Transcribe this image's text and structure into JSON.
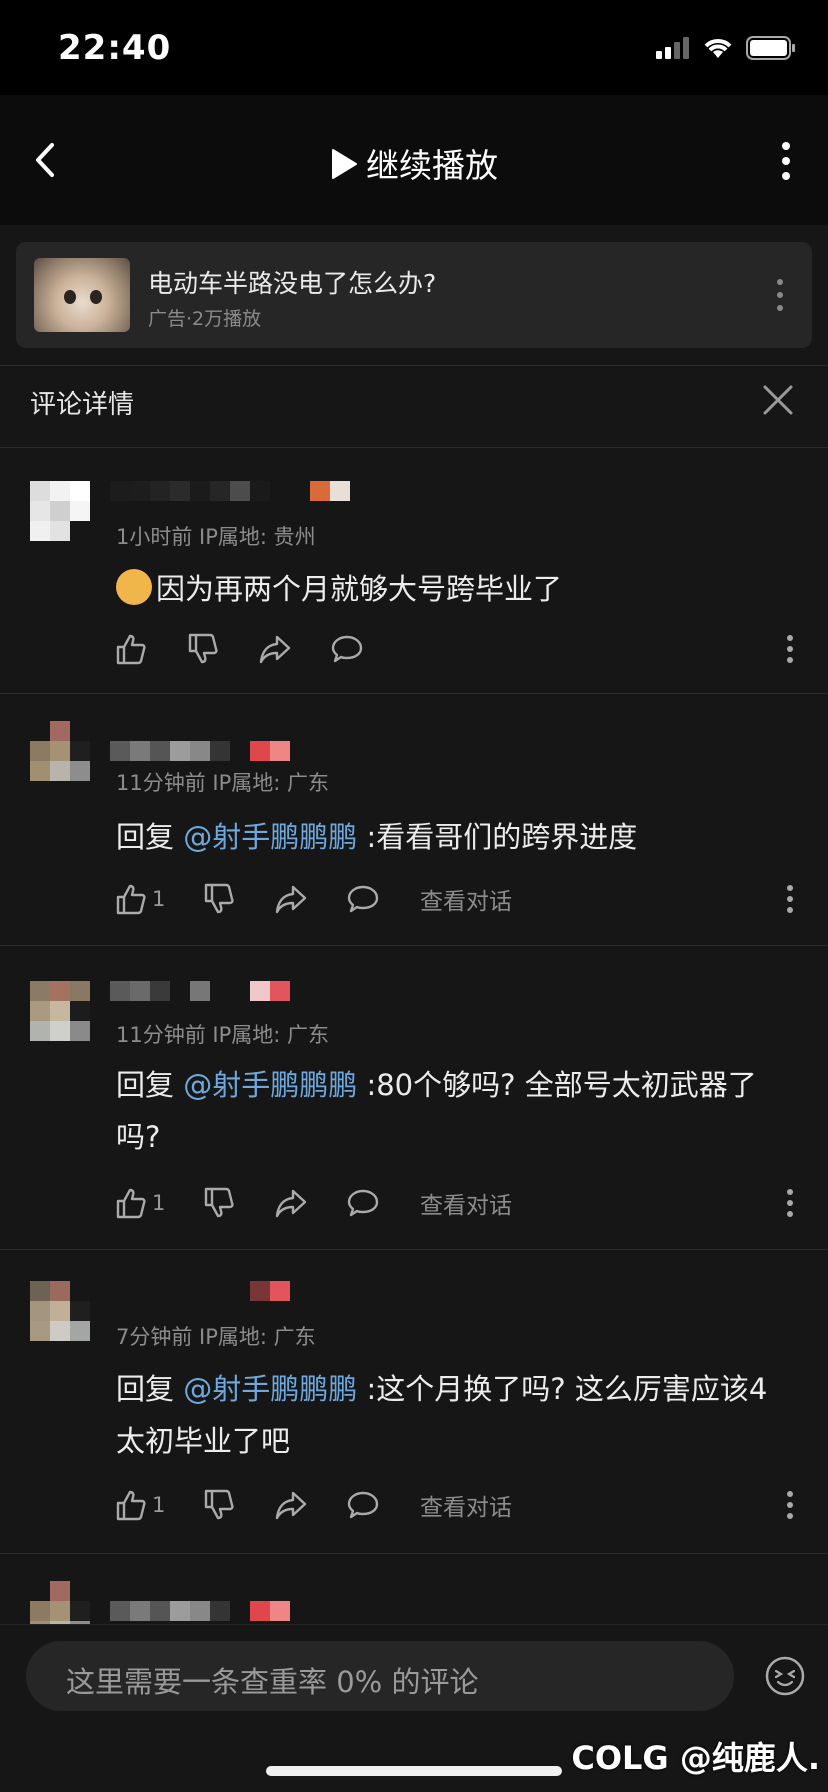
{
  "status": {
    "time": "22:40"
  },
  "nav": {
    "title": "继续播放"
  },
  "ad": {
    "title": "电动车半路没电了怎么办?",
    "subtitle": "广告·2万播放"
  },
  "comments_header": {
    "title": "评论详情"
  },
  "comments": [
    {
      "meta": "1小时前 IP属地: 贵州",
      "text": "因为再两个月就够大号跨毕业了",
      "like_count": ""
    },
    {
      "meta": "11分钟前 IP属地: 广东",
      "reply_prefix": "回复 ",
      "mention": "@射手鹏鹏鹏",
      "text": " :看看哥们的跨界进度",
      "like_count": "1",
      "view_conversation": "查看对话"
    },
    {
      "meta": "11分钟前 IP属地: 广东",
      "reply_prefix": "回复 ",
      "mention": "@射手鹏鹏鹏",
      "text": " :80个够吗? 全部号太初武器了吗?",
      "like_count": "1",
      "view_conversation": "查看对话"
    },
    {
      "meta": "7分钟前 IP属地: 广东",
      "reply_prefix": "回复 ",
      "mention": "@射手鹏鹏鹏",
      "text": " :这个月换了吗? 这么厉害应该4太初毕业了吧",
      "like_count": "1",
      "view_conversation": "查看对话"
    }
  ],
  "input": {
    "placeholder": "这里需要一条查重率 0% 的评论"
  },
  "watermark": "COLG @纯鹿人.",
  "colors": {
    "mention": "#6fa8dc",
    "background": "#161616",
    "card": "#262626"
  },
  "icons": [
    "back-icon",
    "play-icon",
    "more-vertical-icon",
    "close-icon",
    "like-icon",
    "dislike-icon",
    "share-icon",
    "reply-icon",
    "emoji-icon"
  ]
}
